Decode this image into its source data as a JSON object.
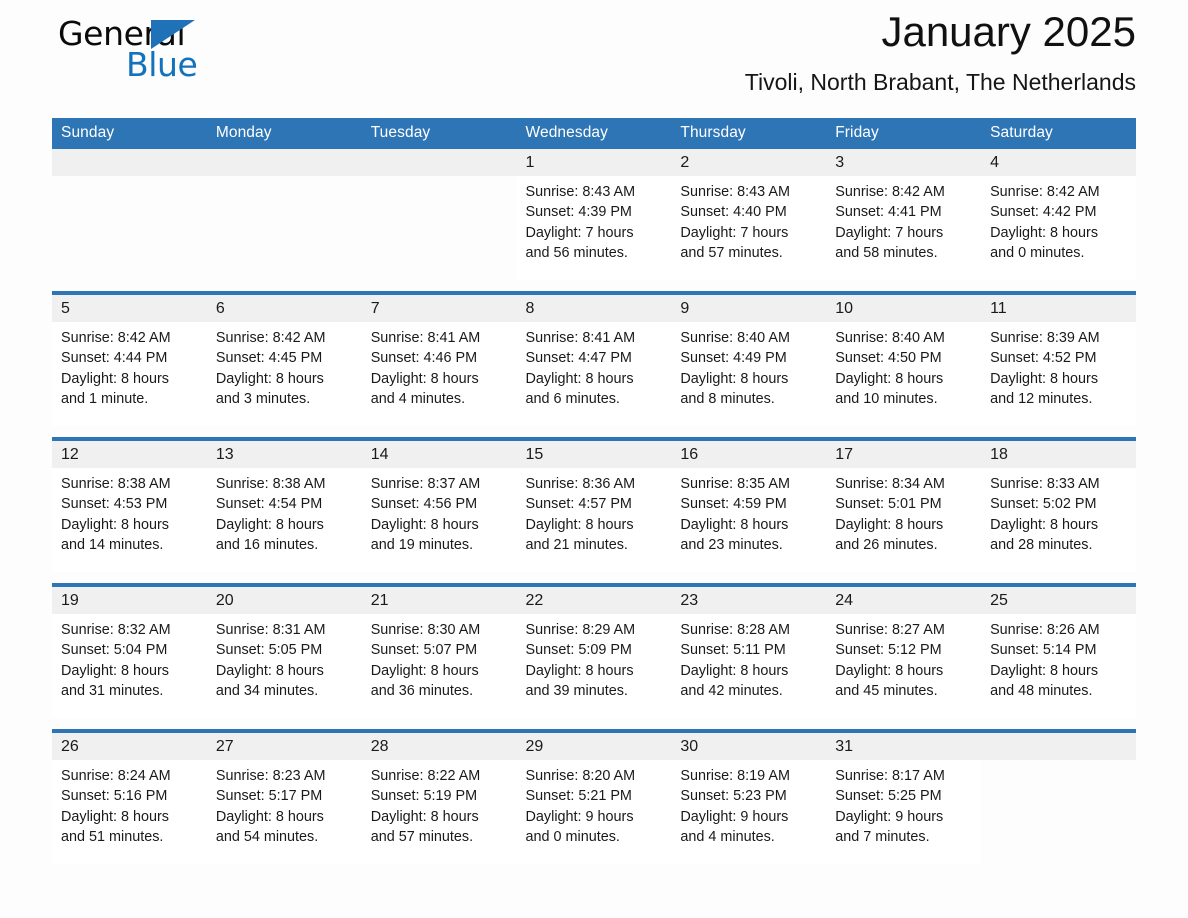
{
  "brand": {
    "name_part1": "General",
    "name_part2": "Blue",
    "accent_color": "#1272bb",
    "triangle_icon": "brand-triangle-icon"
  },
  "header": {
    "month_title": "January 2025",
    "location": "Tivoli, North Brabant, The Netherlands"
  },
  "calendar": {
    "header_bg": "#2e75b6",
    "daynum_bg": "#f0f0f0",
    "weekdays": [
      "Sunday",
      "Monday",
      "Tuesday",
      "Wednesday",
      "Thursday",
      "Friday",
      "Saturday"
    ],
    "weeks": [
      [
        {
          "day": "",
          "lines": []
        },
        {
          "day": "",
          "lines": []
        },
        {
          "day": "",
          "lines": []
        },
        {
          "day": "1",
          "lines": [
            "Sunrise: 8:43 AM",
            "Sunset: 4:39 PM",
            "Daylight: 7 hours",
            "and 56 minutes."
          ]
        },
        {
          "day": "2",
          "lines": [
            "Sunrise: 8:43 AM",
            "Sunset: 4:40 PM",
            "Daylight: 7 hours",
            "and 57 minutes."
          ]
        },
        {
          "day": "3",
          "lines": [
            "Sunrise: 8:42 AM",
            "Sunset: 4:41 PM",
            "Daylight: 7 hours",
            "and 58 minutes."
          ]
        },
        {
          "day": "4",
          "lines": [
            "Sunrise: 8:42 AM",
            "Sunset: 4:42 PM",
            "Daylight: 8 hours",
            "and 0 minutes."
          ]
        }
      ],
      [
        {
          "day": "5",
          "lines": [
            "Sunrise: 8:42 AM",
            "Sunset: 4:44 PM",
            "Daylight: 8 hours",
            "and 1 minute."
          ]
        },
        {
          "day": "6",
          "lines": [
            "Sunrise: 8:42 AM",
            "Sunset: 4:45 PM",
            "Daylight: 8 hours",
            "and 3 minutes."
          ]
        },
        {
          "day": "7",
          "lines": [
            "Sunrise: 8:41 AM",
            "Sunset: 4:46 PM",
            "Daylight: 8 hours",
            "and 4 minutes."
          ]
        },
        {
          "day": "8",
          "lines": [
            "Sunrise: 8:41 AM",
            "Sunset: 4:47 PM",
            "Daylight: 8 hours",
            "and 6 minutes."
          ]
        },
        {
          "day": "9",
          "lines": [
            "Sunrise: 8:40 AM",
            "Sunset: 4:49 PM",
            "Daylight: 8 hours",
            "and 8 minutes."
          ]
        },
        {
          "day": "10",
          "lines": [
            "Sunrise: 8:40 AM",
            "Sunset: 4:50 PM",
            "Daylight: 8 hours",
            "and 10 minutes."
          ]
        },
        {
          "day": "11",
          "lines": [
            "Sunrise: 8:39 AM",
            "Sunset: 4:52 PM",
            "Daylight: 8 hours",
            "and 12 minutes."
          ]
        }
      ],
      [
        {
          "day": "12",
          "lines": [
            "Sunrise: 8:38 AM",
            "Sunset: 4:53 PM",
            "Daylight: 8 hours",
            "and 14 minutes."
          ]
        },
        {
          "day": "13",
          "lines": [
            "Sunrise: 8:38 AM",
            "Sunset: 4:54 PM",
            "Daylight: 8 hours",
            "and 16 minutes."
          ]
        },
        {
          "day": "14",
          "lines": [
            "Sunrise: 8:37 AM",
            "Sunset: 4:56 PM",
            "Daylight: 8 hours",
            "and 19 minutes."
          ]
        },
        {
          "day": "15",
          "lines": [
            "Sunrise: 8:36 AM",
            "Sunset: 4:57 PM",
            "Daylight: 8 hours",
            "and 21 minutes."
          ]
        },
        {
          "day": "16",
          "lines": [
            "Sunrise: 8:35 AM",
            "Sunset: 4:59 PM",
            "Daylight: 8 hours",
            "and 23 minutes."
          ]
        },
        {
          "day": "17",
          "lines": [
            "Sunrise: 8:34 AM",
            "Sunset: 5:01 PM",
            "Daylight: 8 hours",
            "and 26 minutes."
          ]
        },
        {
          "day": "18",
          "lines": [
            "Sunrise: 8:33 AM",
            "Sunset: 5:02 PM",
            "Daylight: 8 hours",
            "and 28 minutes."
          ]
        }
      ],
      [
        {
          "day": "19",
          "lines": [
            "Sunrise: 8:32 AM",
            "Sunset: 5:04 PM",
            "Daylight: 8 hours",
            "and 31 minutes."
          ]
        },
        {
          "day": "20",
          "lines": [
            "Sunrise: 8:31 AM",
            "Sunset: 5:05 PM",
            "Daylight: 8 hours",
            "and 34 minutes."
          ]
        },
        {
          "day": "21",
          "lines": [
            "Sunrise: 8:30 AM",
            "Sunset: 5:07 PM",
            "Daylight: 8 hours",
            "and 36 minutes."
          ]
        },
        {
          "day": "22",
          "lines": [
            "Sunrise: 8:29 AM",
            "Sunset: 5:09 PM",
            "Daylight: 8 hours",
            "and 39 minutes."
          ]
        },
        {
          "day": "23",
          "lines": [
            "Sunrise: 8:28 AM",
            "Sunset: 5:11 PM",
            "Daylight: 8 hours",
            "and 42 minutes."
          ]
        },
        {
          "day": "24",
          "lines": [
            "Sunrise: 8:27 AM",
            "Sunset: 5:12 PM",
            "Daylight: 8 hours",
            "and 45 minutes."
          ]
        },
        {
          "day": "25",
          "lines": [
            "Sunrise: 8:26 AM",
            "Sunset: 5:14 PM",
            "Daylight: 8 hours",
            "and 48 minutes."
          ]
        }
      ],
      [
        {
          "day": "26",
          "lines": [
            "Sunrise: 8:24 AM",
            "Sunset: 5:16 PM",
            "Daylight: 8 hours",
            "and 51 minutes."
          ]
        },
        {
          "day": "27",
          "lines": [
            "Sunrise: 8:23 AM",
            "Sunset: 5:17 PM",
            "Daylight: 8 hours",
            "and 54 minutes."
          ]
        },
        {
          "day": "28",
          "lines": [
            "Sunrise: 8:22 AM",
            "Sunset: 5:19 PM",
            "Daylight: 8 hours",
            "and 57 minutes."
          ]
        },
        {
          "day": "29",
          "lines": [
            "Sunrise: 8:20 AM",
            "Sunset: 5:21 PM",
            "Daylight: 9 hours",
            "and 0 minutes."
          ]
        },
        {
          "day": "30",
          "lines": [
            "Sunrise: 8:19 AM",
            "Sunset: 5:23 PM",
            "Daylight: 9 hours",
            "and 4 minutes."
          ]
        },
        {
          "day": "31",
          "lines": [
            "Sunrise: 8:17 AM",
            "Sunset: 5:25 PM",
            "Daylight: 9 hours",
            "and 7 minutes."
          ]
        },
        {
          "day": "",
          "lines": []
        }
      ]
    ]
  }
}
